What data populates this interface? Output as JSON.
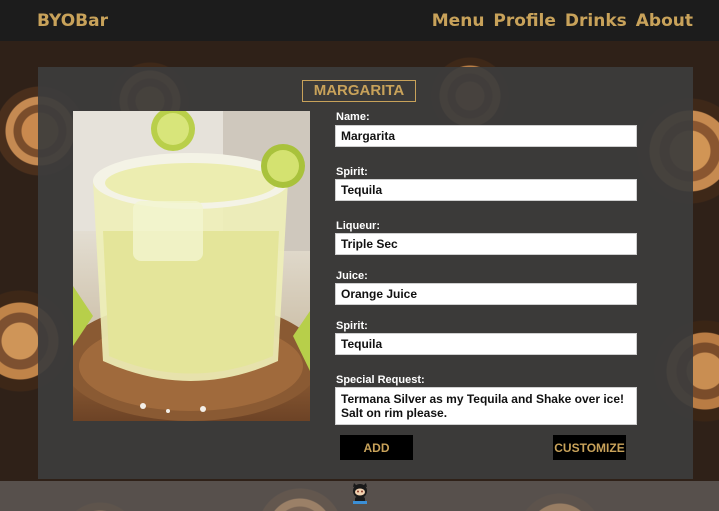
{
  "header": {
    "brand": "BYOBar",
    "nav": [
      "Menu",
      "Profile",
      "Drinks",
      "About"
    ]
  },
  "drink": {
    "title": "MARGARITA",
    "image_icon": "margarita-photo"
  },
  "form": {
    "fields": [
      {
        "label": "Name:",
        "value": "Margarita"
      },
      {
        "label": "Spirit:",
        "value": "Tequila"
      },
      {
        "label": "Liqueur:",
        "value": "Triple Sec"
      },
      {
        "label": "Juice:",
        "value": "Orange Juice"
      },
      {
        "label": "Spirit:",
        "value": "Tequila"
      }
    ],
    "special_request": {
      "label": "Special Request:",
      "value": "Termana Silver as my Tequila and Shake over ice! Salt on rim please."
    }
  },
  "buttons": {
    "add": "ADD",
    "customize": "CUSTOMIZE"
  },
  "footer": {
    "icon": "github-octocat-icon"
  },
  "colors": {
    "accent": "#c8a25a",
    "header_bg": "#1c1c1c",
    "panel_bg": "#3c3c3c"
  }
}
